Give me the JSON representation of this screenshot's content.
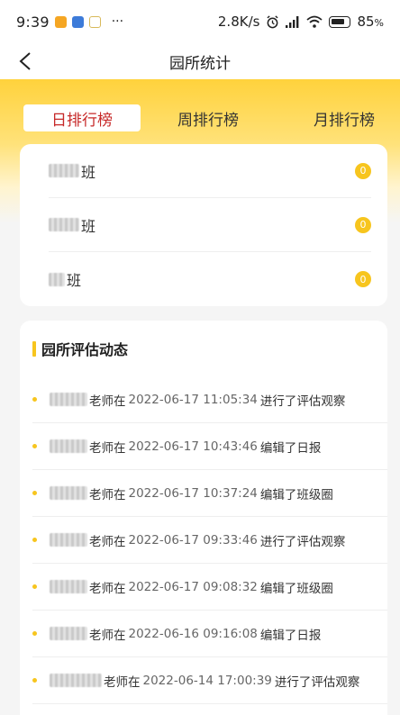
{
  "status_bar": {
    "time": "9:39",
    "dots": "···",
    "net_speed": "2.8K/s",
    "battery": "85"
  },
  "nav": {
    "title": "园所统计",
    "back_icon": "chevron-left-icon"
  },
  "tabs": [
    {
      "label": "日排行榜",
      "active": true
    },
    {
      "label": "周排行榜",
      "active": false
    },
    {
      "label": "月排行榜",
      "active": false
    }
  ],
  "rankings": [
    {
      "name_suffix": "班",
      "count": "0"
    },
    {
      "name_suffix": "班",
      "count": "0"
    },
    {
      "name_suffix": "班",
      "count": "0"
    }
  ],
  "feed": {
    "title": "园所评估动态",
    "items": [
      {
        "prefix": "老师在",
        "time": "2022-06-17 11:05:34",
        "action": "进行了评估观察"
      },
      {
        "prefix": "老师在",
        "time": "2022-06-17 10:43:46",
        "action": "编辑了日报"
      },
      {
        "prefix": "老师在",
        "time": "2022-06-17 10:37:24",
        "action": "编辑了班级圈"
      },
      {
        "prefix": "老师在",
        "time": "2022-06-17 09:33:46",
        "action": "进行了评估观察"
      },
      {
        "prefix": "老师在",
        "time": "2022-06-17 09:08:32",
        "action": "编辑了班级圈"
      },
      {
        "prefix": "老师在",
        "time": "2022-06-16 09:16:08",
        "action": "编辑了日报"
      },
      {
        "prefix": "老师在",
        "time": "2022-06-14 17:00:39",
        "action": "进行了评估观察"
      }
    ]
  },
  "colors": {
    "accent": "#f7c51e",
    "active_tab_text": "#c62828"
  }
}
